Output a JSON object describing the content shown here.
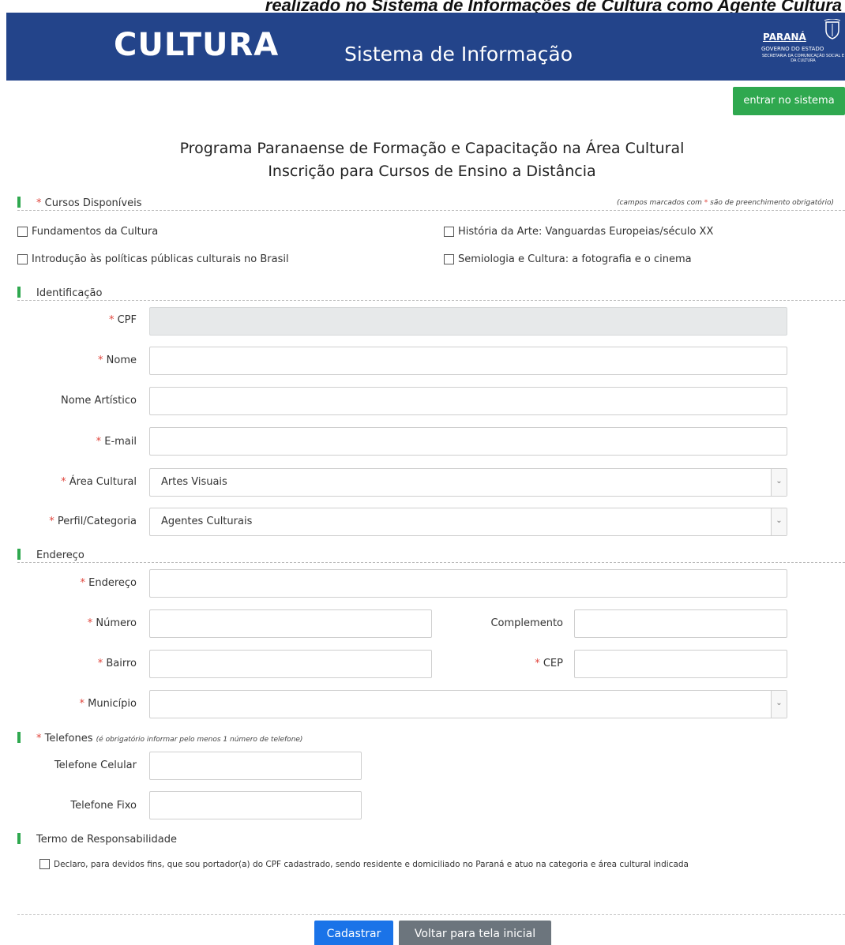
{
  "caption": "realizado no Sistema de Informações de Cultura como Agente Cultura",
  "header": {
    "brand": "CULTURA",
    "brand_sub": "Sistema de Informação",
    "gov_name": "PARANÁ",
    "gov_sub1": "GOVERNO DO ESTADO",
    "gov_sub2": "SECRETARIA DA COMUNICAÇÃO SOCIAL E DA CULTURA"
  },
  "enter_button": "entrar no sistema",
  "title_line1": "Programa Paranaense de Formação e Capacitação na Área Cultural",
  "title_line2": "Inscrição para Cursos de Ensino a Distância",
  "required_mark": "*",
  "courses": {
    "title": "Cursos Disponíveis",
    "note_prefix": "(campos marcados com",
    "note_suffix": "são de preenchimento obrigatório)",
    "items": [
      "Fundamentos da Cultura",
      "História da Arte: Vanguardas Europeias/século XX",
      "Introdução às políticas públicas culturais no Brasil",
      "Semiologia e Cultura: a fotografia e o cinema"
    ]
  },
  "identification": {
    "title": "Identificação",
    "cpf_label": "CPF",
    "nome_label": "Nome",
    "nome_artistico_label": "Nome Artístico",
    "email_label": "E-mail",
    "area_label": "Área Cultural",
    "area_value": "Artes Visuais",
    "perfil_label": "Perfil/Categoria",
    "perfil_value": "Agentes Culturais"
  },
  "address": {
    "title": "Endereço",
    "endereco_label": "Endereço",
    "numero_label": "Número",
    "complemento_label": "Complemento",
    "bairro_label": "Bairro",
    "cep_label": "CEP",
    "municipio_label": "Município"
  },
  "phones": {
    "title": "Telefones",
    "note": "(é obrigatório informar pelo menos 1 número de telefone)",
    "celular_label": "Telefone Celular",
    "fixo_label": "Telefone Fixo"
  },
  "terms": {
    "title": "Termo de Responsabilidade",
    "text": "Declaro, para devidos fins, que sou portador(a) do CPF cadastrado, sendo residente e domiciliado no Paraná e atuo na categoria e área cultural indicada"
  },
  "buttons": {
    "submit": "Cadastrar",
    "back": "Voltar para tela inicial"
  }
}
